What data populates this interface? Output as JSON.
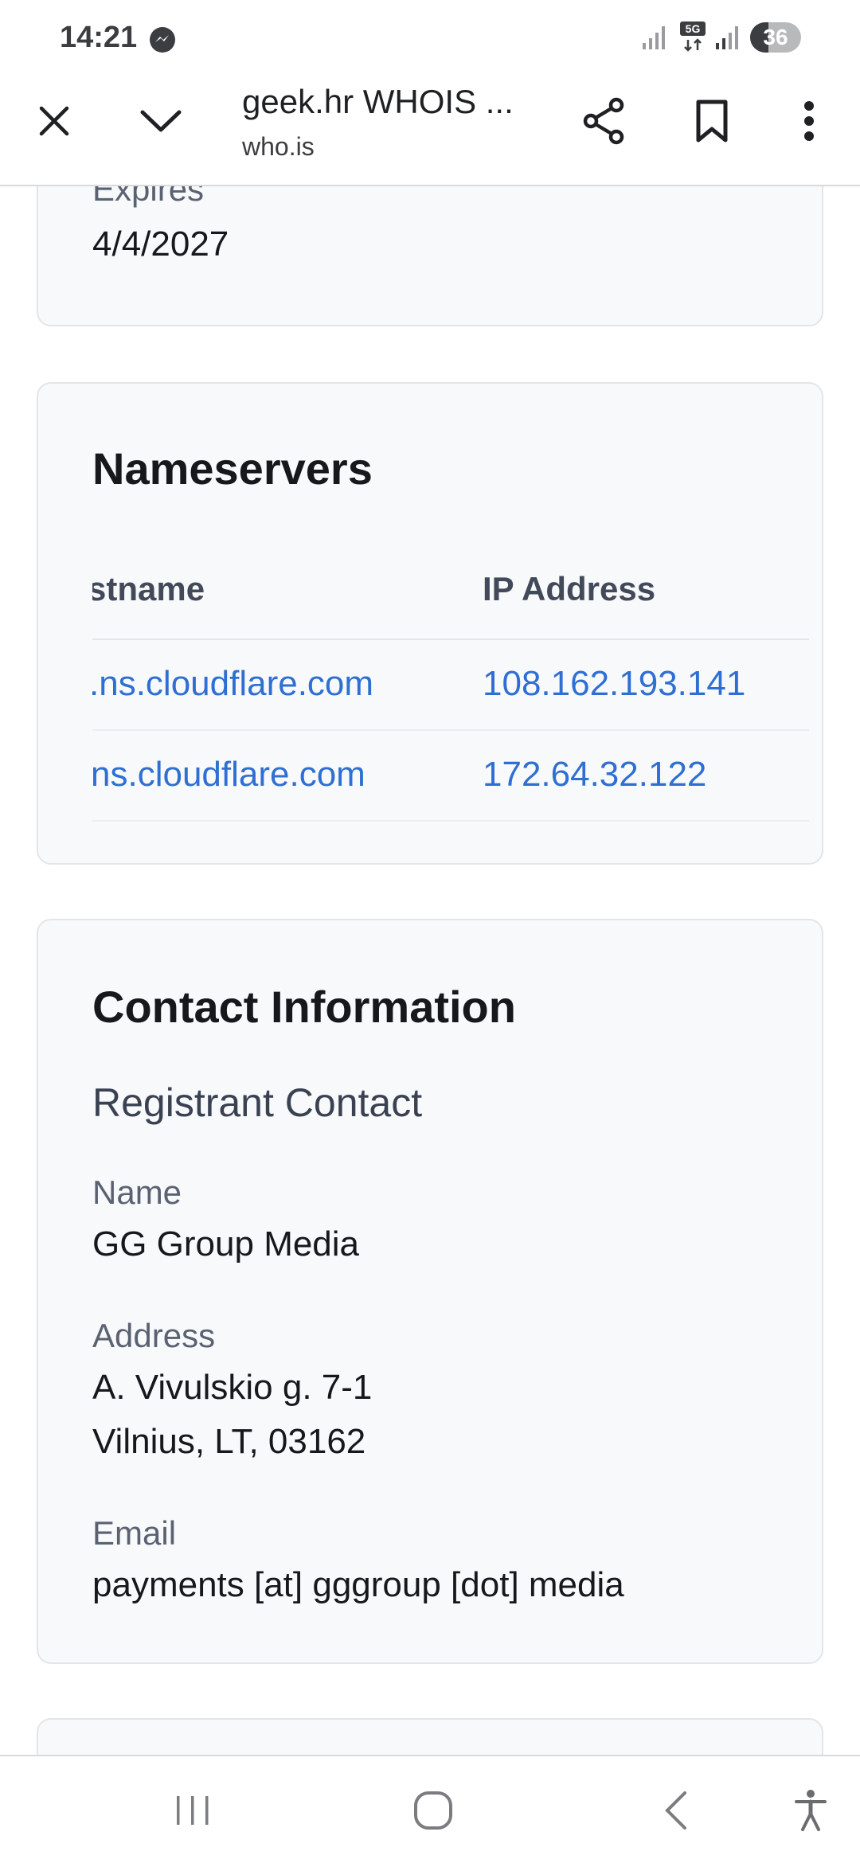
{
  "status_bar": {
    "time": "14:21",
    "battery": "36",
    "icons": [
      "messenger-icon",
      "signal-icon",
      "5g-icon",
      "signal-icon",
      "battery-icon"
    ]
  },
  "toolbar": {
    "title": "geek.hr WHOIS ...",
    "url": "who.is",
    "icons": [
      "close-icon",
      "chevron-down-icon",
      "share-icon",
      "bookmark-icon",
      "more-vert-icon"
    ]
  },
  "dates_card": {
    "expires_label": "Expires",
    "expires_value": "4/4/2027"
  },
  "nameservers": {
    "heading": "Nameservers",
    "columns": [
      "stname",
      "IP Address"
    ],
    "rows": [
      {
        "hostname": ".ns.cloudflare.com",
        "ip": "108.162.193.141"
      },
      {
        "hostname": "ns.cloudflare.com",
        "ip": "172.64.32.122"
      }
    ]
  },
  "contact": {
    "heading": "Contact Information",
    "subheading": "Registrant Contact",
    "name_label": "Name",
    "name_value": "GG Group Media",
    "address_label": "Address",
    "address_line1": "A. Vivulskio g. 7-1",
    "address_line2": "Vilnius, LT, 03162",
    "email_label": "Email",
    "email_value": "payments [at] gggroup [dot] media"
  },
  "nav_bar": {
    "icons": [
      "recent-apps-icon",
      "home-icon",
      "back-icon",
      "accessibility-icon"
    ]
  },
  "colors": {
    "link": "#2f6fd3",
    "card_bg": "#f8f9fb",
    "card_border": "#e3e5e9"
  }
}
